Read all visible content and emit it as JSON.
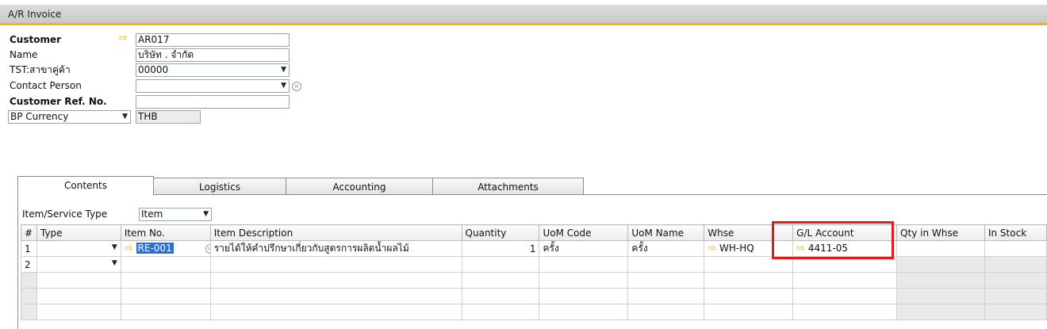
{
  "window": {
    "title": "A/R Invoice"
  },
  "header": {
    "customer_label": "Customer",
    "customer_value": "AR017",
    "name_label": "Name",
    "name_value": "บริษัท .            จำกัด",
    "branch_label": "TST:สาขาคู่ค้า",
    "branch_value": "00000",
    "contact_label": "Contact Person",
    "contact_value": "",
    "ref_label": "Customer Ref. No.",
    "ref_value": "",
    "currency_selector": "BP Currency",
    "currency_value": "THB"
  },
  "tabs": [
    {
      "label": "Contents"
    },
    {
      "label": "Logistics"
    },
    {
      "label": "Accounting"
    },
    {
      "label": "Attachments"
    }
  ],
  "item_type": {
    "label": "Item/Service Type",
    "value": "Item"
  },
  "grid": {
    "columns": [
      "#",
      "Type",
      "Item No.",
      "Item Description",
      "Quantity",
      "UoM Code",
      "UoM Name",
      "Whse",
      "G/L Account",
      "Qty in Whse",
      "In Stock"
    ],
    "rows": [
      {
        "num": "1",
        "item_no": "RE-001",
        "description": "รายได้ให้คำปรึกษาเกี่ยวกับสูตรการผลิตน้ำผลไม้",
        "quantity": "1",
        "uom_code": "ครั้ง",
        "uom_name": "ครั้ง",
        "whse": "WH-HQ",
        "gl_account": "4411-05"
      },
      {
        "num": "2"
      }
    ]
  },
  "icons": {
    "link_arrow": "link-arrow-icon",
    "dropdown": "dropdown-arrow-icon",
    "list": "list-icon"
  },
  "colors": {
    "title_accent": "#f2b21c",
    "link_arrow": "#f4b400",
    "highlight_box": "#e01b1b",
    "selection": "#2f6fd1"
  }
}
